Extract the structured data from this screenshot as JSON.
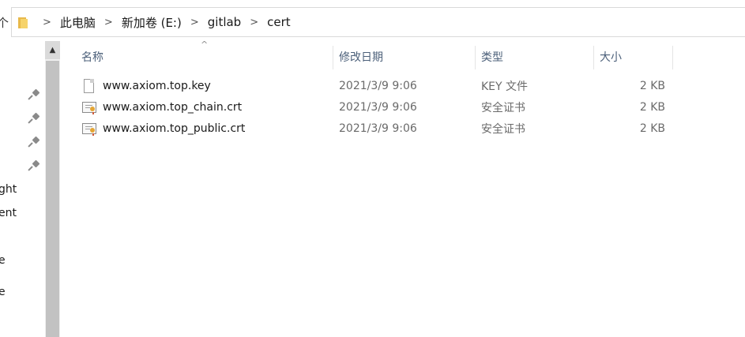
{
  "address_bar": {
    "crumbs": [
      "此电脑",
      "新加卷 (E:)",
      "gitlab",
      "cert"
    ],
    "up_arrow": "个"
  },
  "nav": {
    "fragments": [
      "ght",
      "ent",
      "e",
      "e"
    ]
  },
  "scrollbar": {
    "up_arrow": "▲"
  },
  "columns": {
    "name": "名称",
    "date": "修改日期",
    "type": "类型",
    "size": "大小",
    "sort_indicator": "^"
  },
  "files": [
    {
      "name": "www.axiom.top.key",
      "date": "2021/3/9 9:06",
      "type": "KEY 文件",
      "size": "2 KB",
      "icon": "document-icon"
    },
    {
      "name": "www.axiom.top_chain.crt",
      "date": "2021/3/9 9:06",
      "type": "安全证书",
      "size": "2 KB",
      "icon": "certificate-icon"
    },
    {
      "name": "www.axiom.top_public.crt",
      "date": "2021/3/9 9:06",
      "type": "安全证书",
      "size": "2 KB",
      "icon": "certificate-icon"
    }
  ]
}
